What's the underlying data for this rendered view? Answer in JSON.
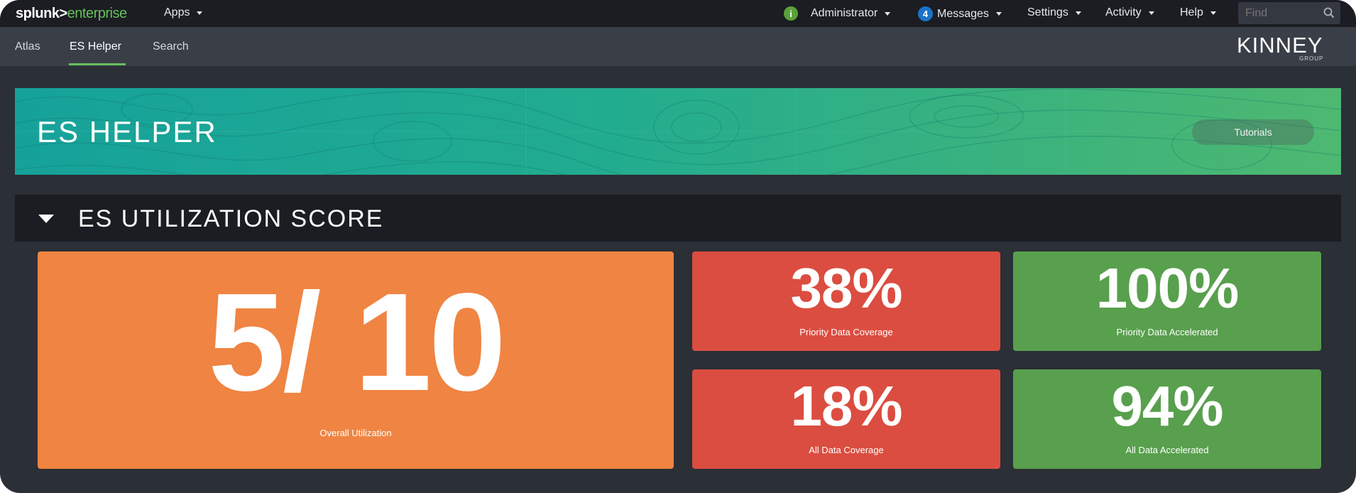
{
  "topbar": {
    "brand_main": "splunk>",
    "brand_rest": "enterprise",
    "apps_label": "Apps",
    "admin_label": "Administrator",
    "admin_badge": "i",
    "messages_count": "4",
    "messages_label": "Messages",
    "settings_label": "Settings",
    "activity_label": "Activity",
    "help_label": "Help",
    "find_placeholder": "Find"
  },
  "appbar": {
    "nav": [
      {
        "label": "Atlas"
      },
      {
        "label": "ES Helper"
      },
      {
        "label": "Search"
      }
    ],
    "active": "ES Helper",
    "logo_main": "KINNEY",
    "logo_sub": "GROUP"
  },
  "banner": {
    "title": "ES HELPER",
    "tutorials_label": "Tutorials"
  },
  "section": {
    "title": "ES UTILIZATION SCORE"
  },
  "panels": {
    "overall": {
      "value": "5/ 10",
      "caption": "Overall Utilization"
    },
    "priority_coverage": {
      "value": "38%",
      "caption": "Priority Data Coverage"
    },
    "priority_accelerated": {
      "value": "100%",
      "caption": "Priority Data Accelerated"
    },
    "all_coverage": {
      "value": "18%",
      "caption": "All Data Coverage"
    },
    "all_accelerated": {
      "value": "94%",
      "caption": "All Data Accelerated"
    }
  },
  "colors": {
    "orange": "#f08442",
    "red": "#db4d40",
    "green": "#58a04d",
    "accent": "#65c05a",
    "banner_start": "#16a29a",
    "banner_end": "#4eb870"
  }
}
